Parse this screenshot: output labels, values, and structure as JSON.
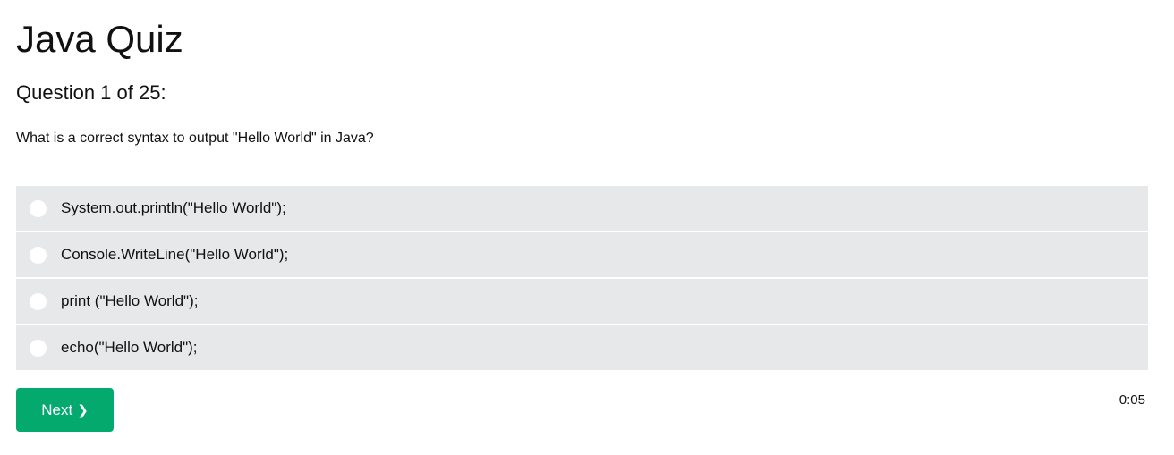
{
  "quiz": {
    "title": "Java Quiz",
    "progress_label": "Question 1 of 25:",
    "question_text": "What is a correct syntax to output \"Hello World\" in Java?",
    "options": [
      {
        "label": "System.out.println(\"Hello World\");"
      },
      {
        "label": "Console.WriteLine(\"Hello World\");"
      },
      {
        "label": "print (\"Hello World\");"
      },
      {
        "label": "echo(\"Hello World\");"
      }
    ],
    "next_button_label": "Next",
    "next_button_icon": "chevron-right-icon",
    "timer": "0:05"
  },
  "colors": {
    "accent": "#04aa6d",
    "option_background": "#e7e8ea"
  }
}
